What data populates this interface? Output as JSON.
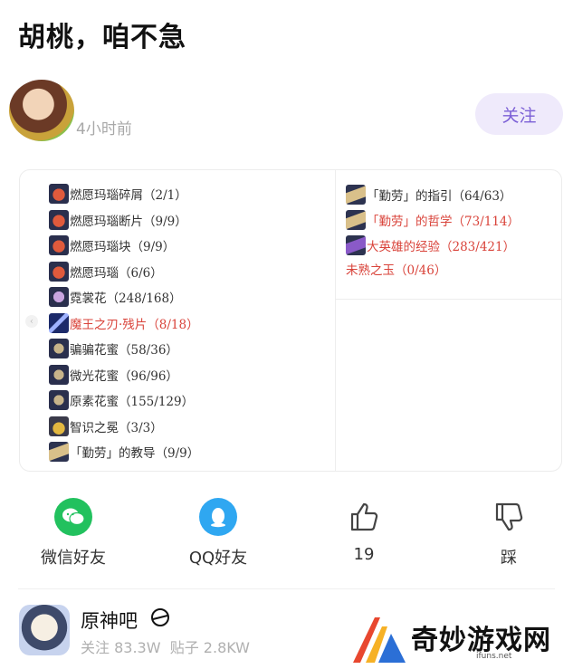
{
  "post": {
    "title": "胡桃，咱不急",
    "time": "4小时前",
    "follow_label": "关注"
  },
  "materials_left": [
    {
      "icon": "red",
      "text": "燃愿玛瑙碎屑（2/1）",
      "highlight": false
    },
    {
      "icon": "red",
      "text": "燃愿玛瑙断片（9/9）",
      "highlight": false
    },
    {
      "icon": "red",
      "text": "燃愿玛瑙块（9/9）",
      "highlight": false
    },
    {
      "icon": "red",
      "text": "燃愿玛瑙（6/6）",
      "highlight": false
    },
    {
      "icon": "flower",
      "text": "霓裳花（248/168）",
      "highlight": false
    },
    {
      "icon": "blade",
      "text": "魔王之刃·残片（8/18）",
      "highlight": true
    },
    {
      "icon": "nectar",
      "text": "骗骗花蜜（58/36）",
      "highlight": false
    },
    {
      "icon": "nectar",
      "text": "微光花蜜（96/96）",
      "highlight": false
    },
    {
      "icon": "nectar",
      "text": "原素花蜜（155/129）",
      "highlight": false
    },
    {
      "icon": "crown",
      "text": "智识之冕（3/3）",
      "highlight": false
    },
    {
      "icon": "book",
      "text": "「勤劳」的教导（9/9）",
      "highlight": false
    }
  ],
  "materials_right": [
    {
      "icon": "book",
      "text": "「勤劳」的指引（64/63）",
      "highlight": false
    },
    {
      "icon": "book",
      "text": "「勤劳」的哲学（73/114）",
      "highlight": true
    },
    {
      "icon": "exp",
      "text": "大英雄的经验（283/421）",
      "highlight": true
    },
    {
      "icon": "",
      "text": "未熟之玉（0/46）",
      "highlight": true
    }
  ],
  "actions": {
    "wechat": "微信好友",
    "qq": "QQ好友",
    "like_count": "19",
    "dislike": "踩"
  },
  "forum": {
    "name": "原神吧",
    "followers": "关注 83.3W",
    "posts": "贴子 2.8KW"
  },
  "watermark": {
    "text": "奇妙游戏网",
    "url": "ifuns.net"
  },
  "colors": {
    "accent": "#7b5fd6",
    "highlight_red": "#d9433a",
    "wechat_green": "#22c15e",
    "qq_blue": "#2fa7f1"
  }
}
